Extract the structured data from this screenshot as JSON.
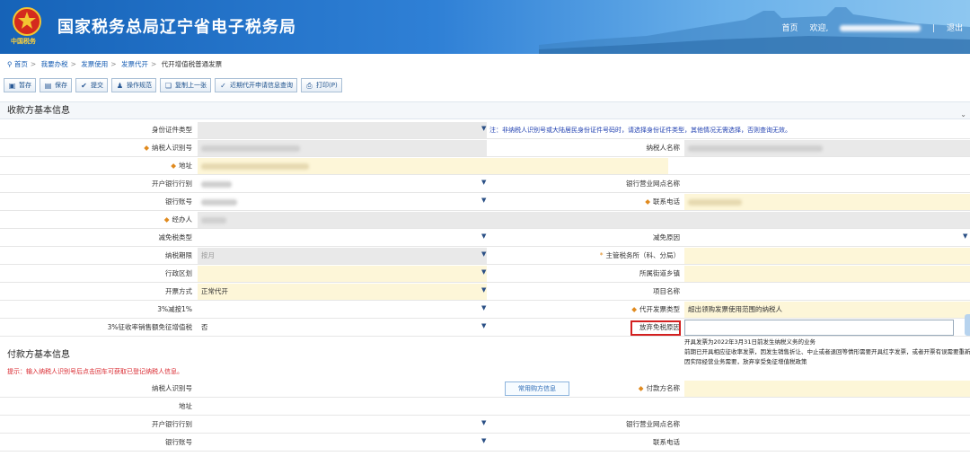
{
  "header": {
    "title": "国家税务总局辽宁省电子税务局",
    "emblem_text": "中国税务",
    "home": "首页",
    "welcome": "欢迎,",
    "separator": "|",
    "logout": "退出"
  },
  "breadcrumb": [
    "首页",
    "我要办税",
    "发票使用",
    "发票代开",
    "代开增值税普通发票"
  ],
  "toolbar": [
    {
      "icon": "disk-icon",
      "label": "暂存"
    },
    {
      "icon": "save-icon",
      "label": "保存"
    },
    {
      "icon": "check-icon",
      "label": "提交"
    },
    {
      "icon": "people-icon",
      "label": "操作规范"
    },
    {
      "icon": "copy-icon",
      "label": "复制上一张"
    },
    {
      "icon": "query-icon",
      "label": "近期代开申请信息查询"
    },
    {
      "icon": "print-icon",
      "label": "打印(P)"
    }
  ],
  "payee": {
    "section_title": "收款方基本信息",
    "id_type_label": "身份证件类型",
    "id_type_note": "注：非纳税人识别号或大陆居民身份证件号码时，请选择身份证件类型，其他情况无需选择，否则查询无效。",
    "taxpayer_id_label": "纳税人识别号",
    "taxpayer_name_label": "纳税人名称",
    "address_label": "地址",
    "bank_label": "开户银行行别",
    "bank_branch_label": "银行营业网点名称",
    "account_label": "银行账号",
    "phone_label": "联系电话",
    "handler_label": "经办人",
    "reduction_type_label": "减免税类型",
    "reduction_reason_label": "减免原因",
    "period_label": "纳税期限",
    "period_value": "按月",
    "tax_office_label": "主管税务所（科、分局）",
    "district_label": "行政区划",
    "street_label": "所属街道乡镇",
    "method_label": "开票方式",
    "method_value": "正常代开",
    "project_label": "项目名称",
    "rate_label": "3%减按1%",
    "invoice_type_label": "代开发票类型",
    "invoice_type_value": "超出领购发票使用范围的纳税人",
    "exempt_label": "3%征收率销售额免征增值税",
    "exempt_value": "否",
    "waive_label": "放弃免税原因"
  },
  "waive_options": [
    "开具发票为2022年3月31日前发生纳税义务的业务",
    "前期已开具相应征收率发票，因发生销售折让、中止或者退回等情形需要开具红字发票，或者开票有误需要重新开具",
    "因实际经营业务需要，放弃享受免征增值税政策"
  ],
  "payer": {
    "section_title": "付款方基本信息",
    "hint": "提示：输入纳税人识别号后点击回车可获取已登记纳税人信息。",
    "taxpayer_id_label": "纳税人识别号",
    "common_button": "常用购方信息",
    "payer_name_label": "付款方名称",
    "address_label": "地址",
    "bank_label": "开户银行行别",
    "bank_branch_label": "银行营业网点名称",
    "account_label": "银行账号",
    "phone_label": "联系电话"
  },
  "colors": {
    "header_blue": "#1663b8",
    "required": "#e08a1e",
    "highlight_red": "#d32020",
    "link_blue": "#1a5fb4"
  }
}
